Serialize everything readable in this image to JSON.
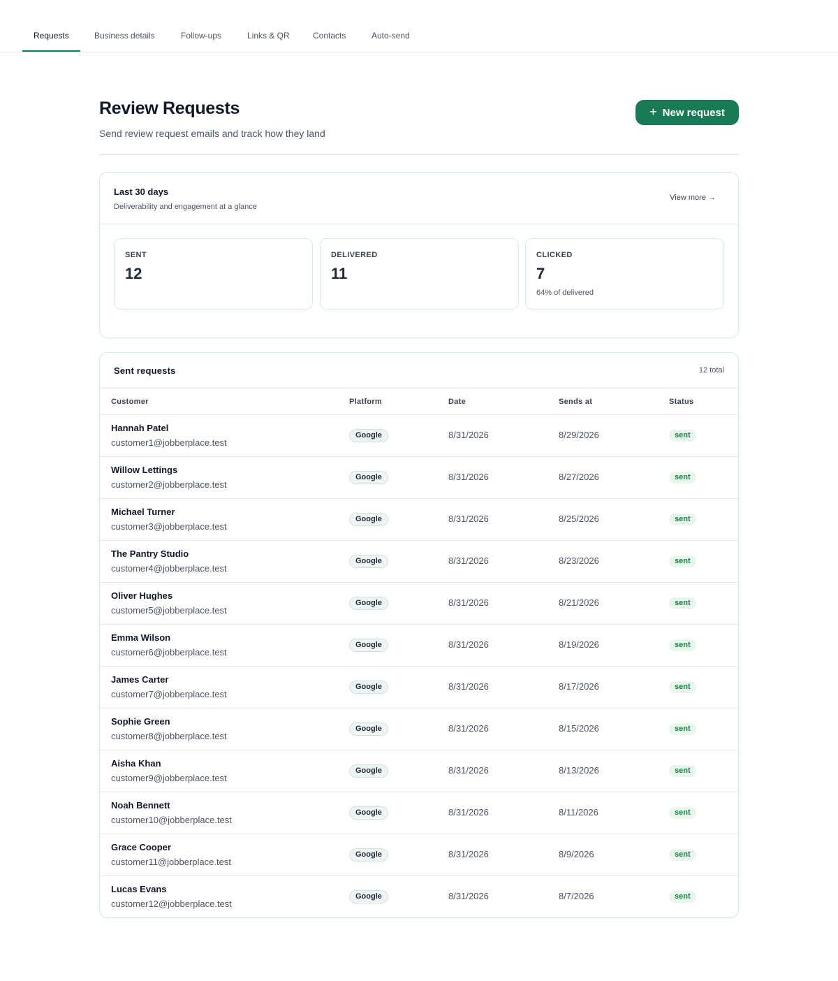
{
  "tabs": [
    {
      "label": "Requests",
      "active": true
    },
    {
      "label": "Business details"
    },
    {
      "label": "Follow-ups"
    },
    {
      "label": "Links & QR"
    },
    {
      "label": "Contacts"
    },
    {
      "label": "Auto-send"
    }
  ],
  "header": {
    "title": "Review Requests",
    "subtitle": "Send review request emails and track how they land",
    "new_request_label": "New request",
    "new_request_icon": "plus-icon"
  },
  "stats": {
    "title": "Last 30 days",
    "subtitle": "Deliverability and engagement at a glance",
    "view_more": "View more →",
    "sent": {
      "label": "SENT",
      "value": "12"
    },
    "delivered": {
      "label": "DELIVERED",
      "value": "11"
    },
    "clicked": {
      "label": "CLICKED",
      "value": "7",
      "note": "64% of delivered"
    }
  },
  "table": {
    "title": "Sent requests",
    "total": "12 total",
    "columns": {
      "customer": "Customer",
      "platform": "Platform",
      "date": "Date",
      "sends_at": "Sends at",
      "status": "Status"
    },
    "rows": [
      {
        "name": "Hannah Patel",
        "email": "customer1@jobberplace.test",
        "platform": "Google",
        "date": "8/31/2026",
        "sends_at": "8/29/2026",
        "status": "sent"
      },
      {
        "name": "Willow Lettings",
        "email": "customer2@jobberplace.test",
        "platform": "Google",
        "date": "8/31/2026",
        "sends_at": "8/27/2026",
        "status": "sent"
      },
      {
        "name": "Michael Turner",
        "email": "customer3@jobberplace.test",
        "platform": "Google",
        "date": "8/31/2026",
        "sends_at": "8/25/2026",
        "status": "sent"
      },
      {
        "name": "The Pantry Studio",
        "email": "customer4@jobberplace.test",
        "platform": "Google",
        "date": "8/31/2026",
        "sends_at": "8/23/2026",
        "status": "sent"
      },
      {
        "name": "Oliver Hughes",
        "email": "customer5@jobberplace.test",
        "platform": "Google",
        "date": "8/31/2026",
        "sends_at": "8/21/2026",
        "status": "sent"
      },
      {
        "name": "Emma Wilson",
        "email": "customer6@jobberplace.test",
        "platform": "Google",
        "date": "8/31/2026",
        "sends_at": "8/19/2026",
        "status": "sent"
      },
      {
        "name": "James Carter",
        "email": "customer7@jobberplace.test",
        "platform": "Google",
        "date": "8/31/2026",
        "sends_at": "8/17/2026",
        "status": "sent"
      },
      {
        "name": "Sophie Green",
        "email": "customer8@jobberplace.test",
        "platform": "Google",
        "date": "8/31/2026",
        "sends_at": "8/15/2026",
        "status": "sent"
      },
      {
        "name": "Aisha Khan",
        "email": "customer9@jobberplace.test",
        "platform": "Google",
        "date": "8/31/2026",
        "sends_at": "8/13/2026",
        "status": "sent"
      },
      {
        "name": "Noah Bennett",
        "email": "customer10@jobberplace.test",
        "platform": "Google",
        "date": "8/31/2026",
        "sends_at": "8/11/2026",
        "status": "sent"
      },
      {
        "name": "Grace Cooper",
        "email": "customer11@jobberplace.test",
        "platform": "Google",
        "date": "8/31/2026",
        "sends_at": "8/9/2026",
        "status": "sent"
      },
      {
        "name": "Lucas Evans",
        "email": "customer12@jobberplace.test",
        "platform": "Google",
        "date": "8/31/2026",
        "sends_at": "8/7/2026",
        "status": "sent"
      }
    ]
  },
  "colors": {
    "accent": "#1a7a55",
    "status_sent": "#15803d",
    "status_sent_bg": "#e8f6ee",
    "border": "#d5ebe3"
  }
}
